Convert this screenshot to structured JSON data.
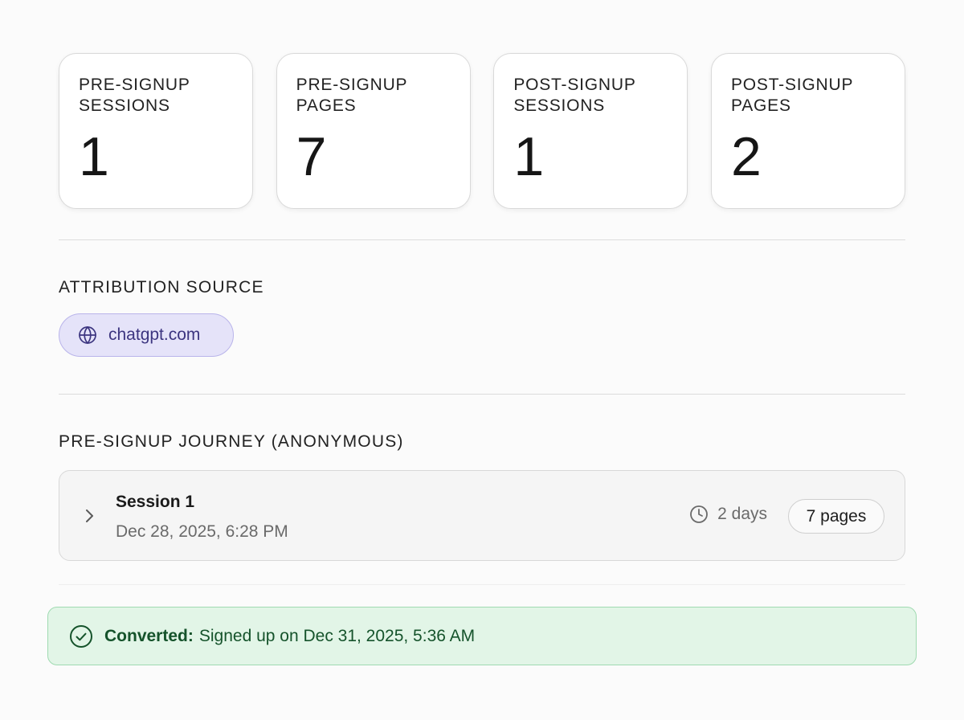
{
  "stats": [
    {
      "label": "PRE-SIGNUP SESSIONS",
      "value": "1"
    },
    {
      "label": "PRE-SIGNUP PAGES",
      "value": "7"
    },
    {
      "label": "POST-SIGNUP SESSIONS",
      "value": "1"
    },
    {
      "label": "POST-SIGNUP PAGES",
      "value": "2"
    }
  ],
  "attribution": {
    "title": "ATTRIBUTION SOURCE",
    "source": "chatgpt.com",
    "icon": "globe-icon"
  },
  "journey": {
    "title": "PRE-SIGNUP JOURNEY (ANONYMOUS)",
    "sessions": [
      {
        "title": "Session 1",
        "date": "Dec 28, 2025, 6:28 PM",
        "duration": "2 days",
        "pages": "7 pages"
      }
    ]
  },
  "conversion": {
    "label": "Converted:",
    "text": "Signed up on Dec 31, 2025, 5:36 AM",
    "icon": "check-circle-icon"
  },
  "colors": {
    "source_pill_bg": "#e5e3f9",
    "source_pill_text": "#3c3580",
    "converted_bg": "#e2f5e7",
    "converted_text": "#15532b"
  }
}
